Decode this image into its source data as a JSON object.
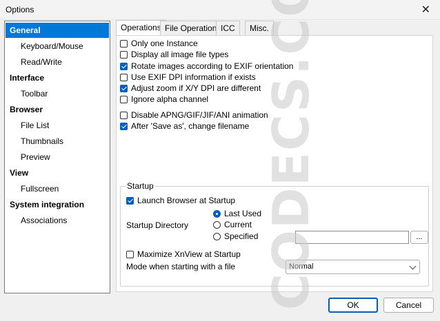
{
  "window": {
    "title": "Options",
    "close_glyph": "✕"
  },
  "sidebar": {
    "items": [
      {
        "label": "General",
        "type": "cat",
        "selected": true
      },
      {
        "label": "Keyboard/Mouse",
        "type": "sub"
      },
      {
        "label": "Read/Write",
        "type": "sub"
      },
      {
        "label": "Interface",
        "type": "cat"
      },
      {
        "label": "Toolbar",
        "type": "sub"
      },
      {
        "label": "Browser",
        "type": "cat"
      },
      {
        "label": "File List",
        "type": "sub"
      },
      {
        "label": "Thumbnails",
        "type": "sub"
      },
      {
        "label": "Preview",
        "type": "sub"
      },
      {
        "label": "View",
        "type": "cat"
      },
      {
        "label": "Fullscreen",
        "type": "sub"
      },
      {
        "label": "System integration",
        "type": "cat"
      },
      {
        "label": "Associations",
        "type": "sub"
      }
    ]
  },
  "tabs": [
    {
      "label": "Operations",
      "active": true
    },
    {
      "label": "File Operations"
    },
    {
      "label": "ICC"
    },
    {
      "label": "Misc."
    }
  ],
  "options": [
    {
      "label": "Only one Instance",
      "checked": false
    },
    {
      "label": "Display all image file types",
      "checked": false
    },
    {
      "label": "Rotate images according to EXIF orientation",
      "checked": true
    },
    {
      "label": "Use EXIF DPI information if exists",
      "checked": false
    },
    {
      "label": "Adjust zoom if X/Y DPI are different",
      "checked": true
    },
    {
      "label": "Ignore alpha channel",
      "checked": false
    },
    {
      "label": "Disable APNG/GIF/JIF/ANI animation",
      "checked": false
    },
    {
      "label": "After 'Save as', change filename",
      "checked": true
    }
  ],
  "startup": {
    "group_label": "Startup",
    "launch_browser": {
      "label": "Launch Browser at Startup",
      "checked": true
    },
    "directory_label": "Startup Directory",
    "radios": [
      {
        "label": "Last Used",
        "checked": true
      },
      {
        "label": "Current",
        "checked": false
      },
      {
        "label": "Specified",
        "checked": false
      }
    ],
    "directory_value": "",
    "browse_label": "...",
    "maximize": {
      "label": "Maximize XnView at Startup",
      "checked": false
    },
    "mode_label": "Mode when starting with a file",
    "mode_value": "Normal"
  },
  "buttons": {
    "ok": "OK",
    "cancel": "Cancel"
  },
  "watermark": "CODECS.COM"
}
